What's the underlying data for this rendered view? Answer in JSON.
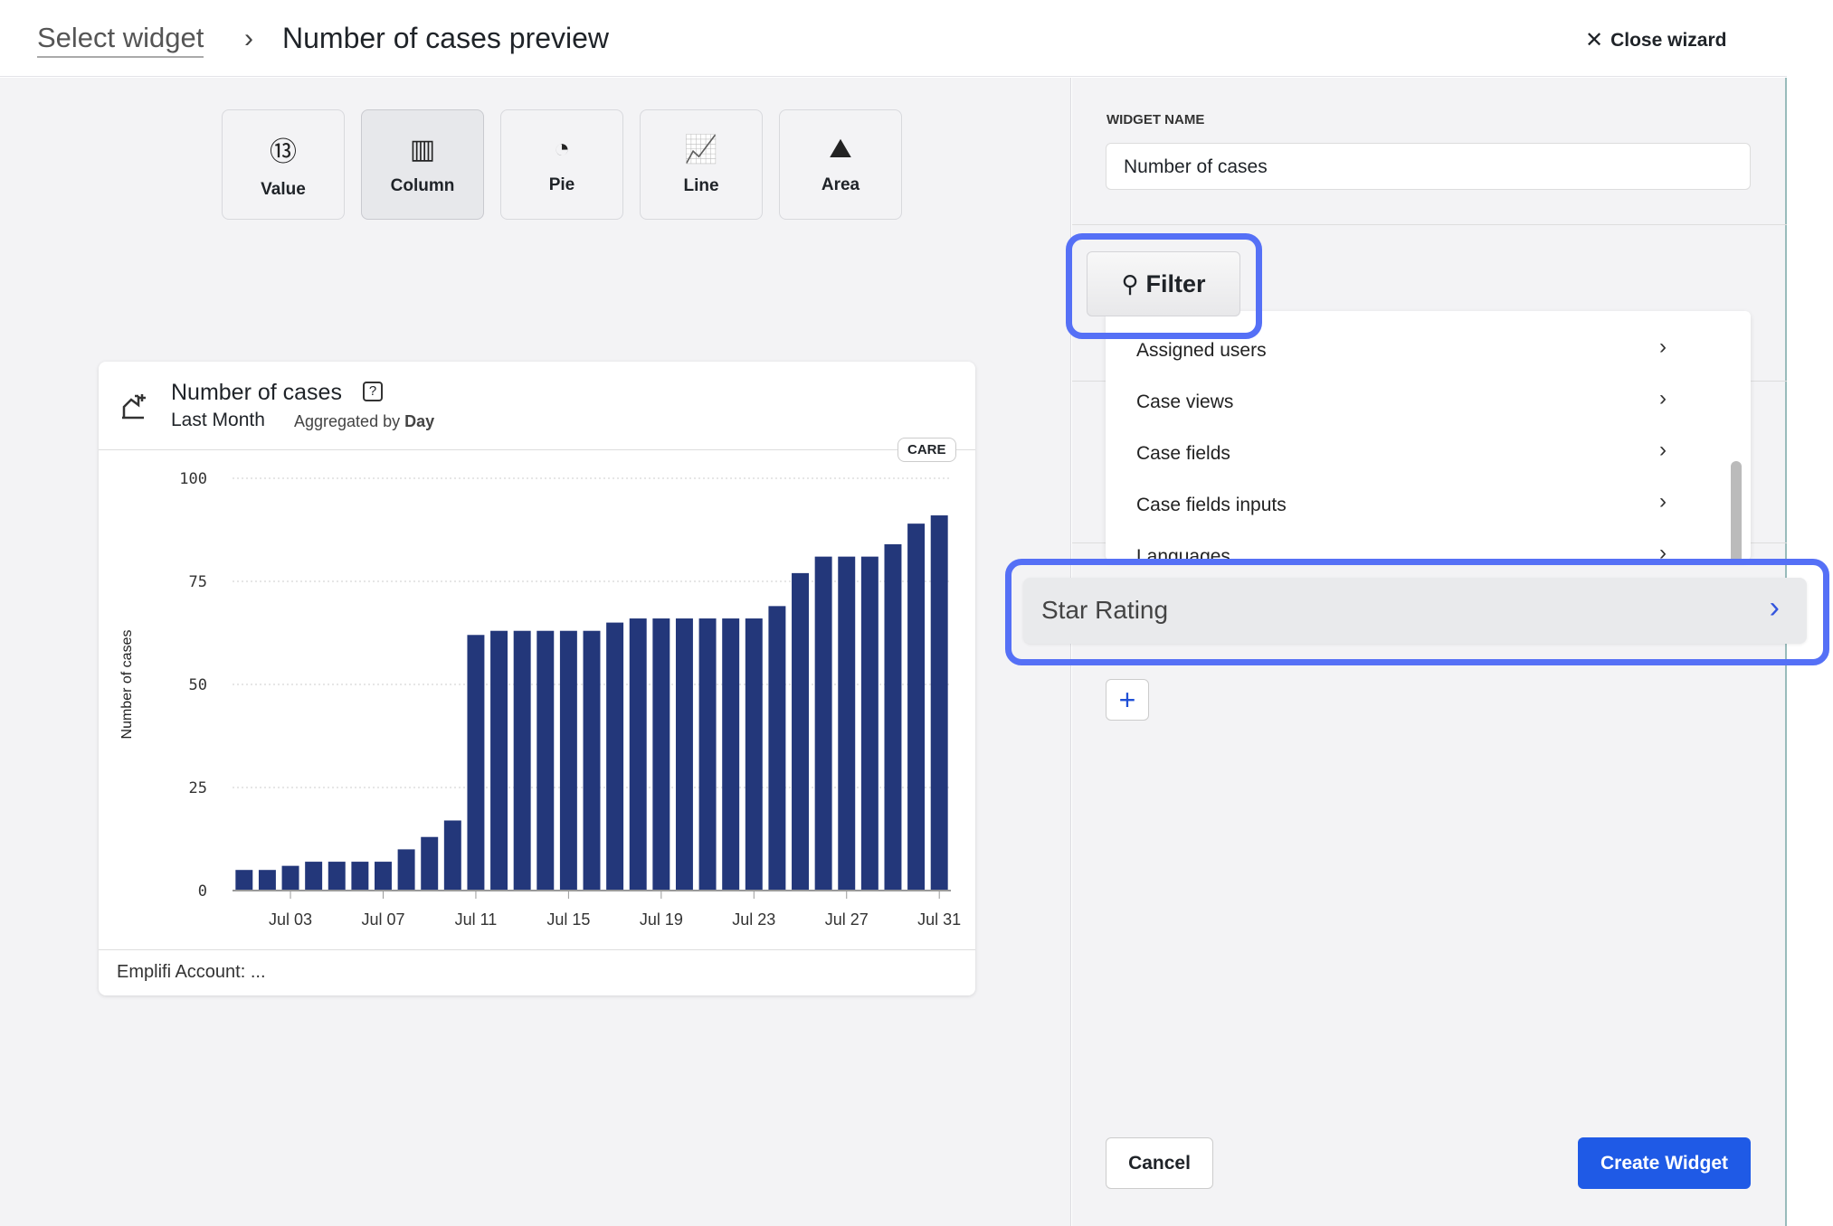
{
  "header": {
    "breadcrumb_link": "Select widget",
    "separator": "›",
    "title": "Number of cases preview",
    "close_label": "Close wizard"
  },
  "chart_types": [
    {
      "label": "Value",
      "icon": "value-icon"
    },
    {
      "label": "Column",
      "icon": "column-chart-icon",
      "selected": true
    },
    {
      "label": "Pie",
      "icon": "pie-chart-icon"
    },
    {
      "label": "Line",
      "icon": "line-chart-icon"
    },
    {
      "label": "Area",
      "icon": "area-chart-icon"
    }
  ],
  "card": {
    "title": "Number of cases",
    "help": "?",
    "period": "Last Month",
    "aggregated_prefix": "Aggregated by",
    "aggregated_value": "Day",
    "badge": "CARE",
    "footer": "Emplifi Account: ..."
  },
  "chart_data": {
    "type": "bar",
    "title": "",
    "xlabel": "",
    "ylabel": "Number of cases",
    "ylim": [
      0,
      100
    ],
    "yticks": [
      0,
      25,
      50,
      75,
      100
    ],
    "categories": [
      "Jul 01",
      "Jul 02",
      "Jul 03",
      "Jul 04",
      "Jul 05",
      "Jul 06",
      "Jul 07",
      "Jul 08",
      "Jul 09",
      "Jul 10",
      "Jul 11",
      "Jul 12",
      "Jul 13",
      "Jul 14",
      "Jul 15",
      "Jul 16",
      "Jul 17",
      "Jul 18",
      "Jul 19",
      "Jul 20",
      "Jul 21",
      "Jul 22",
      "Jul 23",
      "Jul 24",
      "Jul 25",
      "Jul 26",
      "Jul 27",
      "Jul 28",
      "Jul 29",
      "Jul 30",
      "Jul 31"
    ],
    "xtick_labels": [
      "Jul 03",
      "Jul 07",
      "Jul 11",
      "Jul 15",
      "Jul 19",
      "Jul 23",
      "Jul 27",
      "Jul 31"
    ],
    "values": [
      5,
      5,
      6,
      7,
      7,
      7,
      7,
      10,
      13,
      17,
      62,
      63,
      63,
      63,
      63,
      63,
      65,
      66,
      66,
      66,
      66,
      66,
      66,
      69,
      77,
      81,
      81,
      81,
      84,
      89,
      91
    ],
    "color": "#23377a",
    "grid": true
  },
  "sidebar": {
    "widget_name_label": "WIDGET NAME",
    "widget_name_value": "Number of cases",
    "filter_label": "Filter",
    "menu": [
      "Assigned users",
      "Case views",
      "Case fields",
      "Case fields inputs",
      "Languages"
    ],
    "highlighted_item": "Star Rating",
    "add_label": "+",
    "cancel_label": "Cancel",
    "create_label": "Create Widget"
  },
  "colors": {
    "accent": "#1f5ae6",
    "highlight": "#5570f6",
    "bar": "#23377a"
  }
}
